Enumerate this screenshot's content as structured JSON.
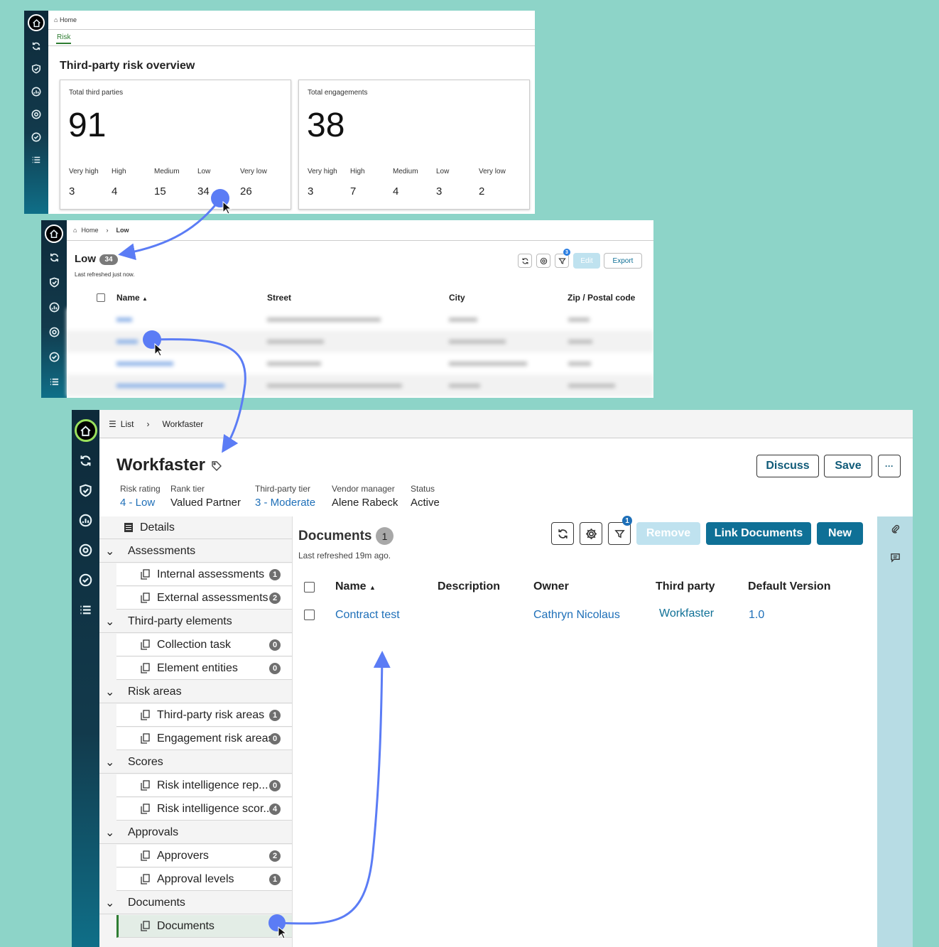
{
  "panel1": {
    "breadcrumb_home": "Home",
    "tab": "Risk",
    "heading": "Third-party risk overview",
    "cards": [
      {
        "title": "Total third parties",
        "total": "91",
        "levels": [
          {
            "label": "Very high",
            "value": "3"
          },
          {
            "label": "High",
            "value": "4"
          },
          {
            "label": "Medium",
            "value": "15"
          },
          {
            "label": "Low",
            "value": "34"
          },
          {
            "label": "Very low",
            "value": "26"
          }
        ]
      },
      {
        "title": "Total engagements",
        "total": "38",
        "levels": [
          {
            "label": "Very high",
            "value": "3"
          },
          {
            "label": "High",
            "value": "7"
          },
          {
            "label": "Medium",
            "value": "4"
          },
          {
            "label": "Low",
            "value": "3"
          },
          {
            "label": "Very low",
            "value": "2"
          }
        ]
      }
    ]
  },
  "panel2": {
    "breadcrumb": [
      "Home",
      "Low"
    ],
    "title": "Low",
    "count": "34",
    "refreshed": "Last refreshed just now.",
    "filter_count": "3",
    "edit_label": "Edit",
    "export_label": "Export",
    "columns": [
      "Name",
      "Street",
      "City",
      "Zip / Postal code"
    ]
  },
  "panel3": {
    "breadcrumb": [
      "List",
      "Workfaster"
    ],
    "title": "Workfaster",
    "buttons": {
      "discuss": "Discuss",
      "save": "Save",
      "more": "···"
    },
    "fields": [
      {
        "label": "Risk rating",
        "value": "4 - Low"
      },
      {
        "label": "Rank tier",
        "value": "Valued Partner"
      },
      {
        "label": "Third-party tier",
        "value": "3 - Moderate"
      },
      {
        "label": "Vendor manager",
        "value": "Alene Rabeck"
      },
      {
        "label": "Status",
        "value": "Active"
      }
    ],
    "nav": {
      "details": "Details",
      "groups": [
        {
          "label": "Assessments",
          "items": [
            {
              "label": "Internal assessments",
              "count": "1"
            },
            {
              "label": "External assessments",
              "count": "2"
            }
          ]
        },
        {
          "label": "Third-party elements",
          "items": [
            {
              "label": "Collection task",
              "count": "0"
            },
            {
              "label": "Element entities",
              "count": "0"
            }
          ]
        },
        {
          "label": "Risk areas",
          "items": [
            {
              "label": "Third-party risk areas",
              "count": "1"
            },
            {
              "label": "Engagement risk areas",
              "count": "0"
            }
          ]
        },
        {
          "label": "Scores",
          "items": [
            {
              "label": "Risk intelligence rep...",
              "count": "0"
            },
            {
              "label": "Risk intelligence scor...",
              "count": "4"
            }
          ]
        },
        {
          "label": "Approvals",
          "items": [
            {
              "label": "Approvers",
              "count": "2"
            },
            {
              "label": "Approval levels",
              "count": "1"
            }
          ]
        },
        {
          "label": "Documents",
          "items": [
            {
              "label": "Documents",
              "count": ""
            }
          ]
        }
      ]
    },
    "documents": {
      "title": "Documents",
      "count": "1",
      "refreshed": "Last refreshed 19m ago.",
      "filter_count": "1",
      "remove_label": "Remove",
      "link_label": "Link Documents",
      "new_label": "New",
      "columns": [
        "Name",
        "Description",
        "Owner",
        "Third party",
        "Default Version"
      ],
      "rows": [
        {
          "name": "Contract test",
          "description": "",
          "owner": "Cathryn Nicolaus",
          "third_party": "Workfaster",
          "version": "1.0"
        }
      ]
    }
  },
  "colors": {
    "accent": "#0f7096",
    "link": "#1e6fb8",
    "annotation": "#5b7cf5",
    "active_nav": "#e3ede6"
  }
}
